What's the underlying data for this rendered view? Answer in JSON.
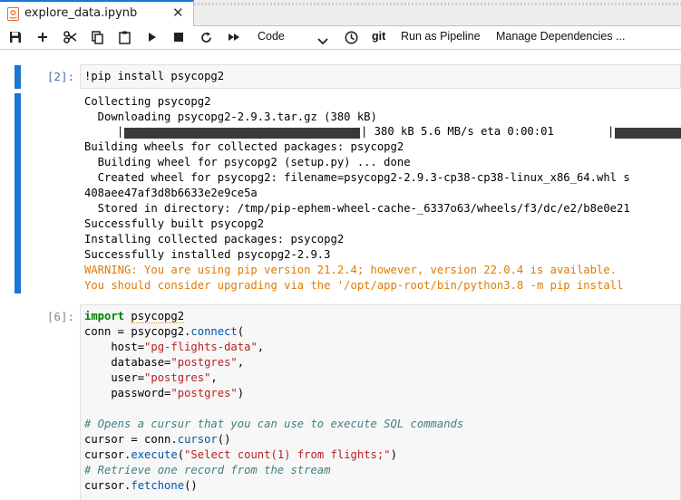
{
  "tab": {
    "title": "explore_data.ipynb",
    "close": "✕"
  },
  "toolbar": {
    "cell_type": "Code",
    "git_label": "git",
    "run_pipeline": "Run as Pipeline",
    "manage_deps": "Manage Dependencies ..."
  },
  "cells": [
    {
      "prompt": "[2]:",
      "source": "!pip install psycopg2",
      "output": {
        "line1": "Collecting psycopg2",
        "line2": "  Downloading psycopg2-2.9.3.tar.gz (380 kB)",
        "progress_text": "| 380 kB 5.6 MB/s eta 0:00:01",
        "progress_fraction": 1.0,
        "line4": "Building wheels for collected packages: psycopg2",
        "line5": "  Building wheel for psycopg2 (setup.py) ... done",
        "line6": "  Created wheel for psycopg2: filename=psycopg2-2.9.3-cp38-cp38-linux_x86_64.whl s",
        "line7": "408aee47af3d8b6633e2e9ce5a",
        "line8": "  Stored in directory: /tmp/pip-ephem-wheel-cache-_6337o63/wheels/f3/dc/e2/b8e0e21",
        "line9": "Successfully built psycopg2",
        "line10": "Installing collected packages: psycopg2",
        "line11": "Successfully installed psycopg2-2.9.3",
        "warn1": "WARNING: You are using pip version 21.2.4; however, version 22.0.4 is available.",
        "warn2": "You should consider upgrading via the '/opt/app-root/bin/python3.8 -m pip install"
      }
    },
    {
      "prompt": "[6]:",
      "lines": {
        "l1_kw": "import",
        "l1_mod": "psycopg2",
        "l2_a": "conn = psycopg2.",
        "l2_fn": "connect",
        "l2_b": "(",
        "l3_a": "    host=",
        "l3_s": "\"pg-flights-data\"",
        "l3_b": ",",
        "l4_a": "    database=",
        "l4_s": "\"postgres\"",
        "l4_b": ",",
        "l5_a": "    user=",
        "l5_s": "\"postgres\"",
        "l5_b": ",",
        "l6_a": "    password=",
        "l6_s": "\"postgres\"",
        "l6_b": ")",
        "l8_cm": "# Opens a cursur that you can use to execute SQL commands",
        "l9_a": "cursor = conn.",
        "l9_fn": "cursor",
        "l9_b": "()",
        "l10_a": "cursor.",
        "l10_fn": "execute",
        "l10_b": "(",
        "l10_s": "\"Select count(1) from flights;\"",
        "l10_c": ")",
        "l11_cm": "# Retrieve one record from the stream",
        "l12_a": "cursor.",
        "l12_fn": "fetchone",
        "l12_b": "()"
      }
    }
  ],
  "colors": {
    "accent": "#1976d2",
    "warning": "#e07b00",
    "string": "#ba2121",
    "keyword": "#008000",
    "comment": "#408080"
  },
  "icons": [
    "notebook-icon",
    "close-icon",
    "save-icon",
    "add-cell-icon",
    "cut-icon",
    "copy-icon",
    "paste-icon",
    "run-icon",
    "stop-icon",
    "restart-icon",
    "run-all-icon",
    "chevron-down-icon",
    "history-icon"
  ]
}
